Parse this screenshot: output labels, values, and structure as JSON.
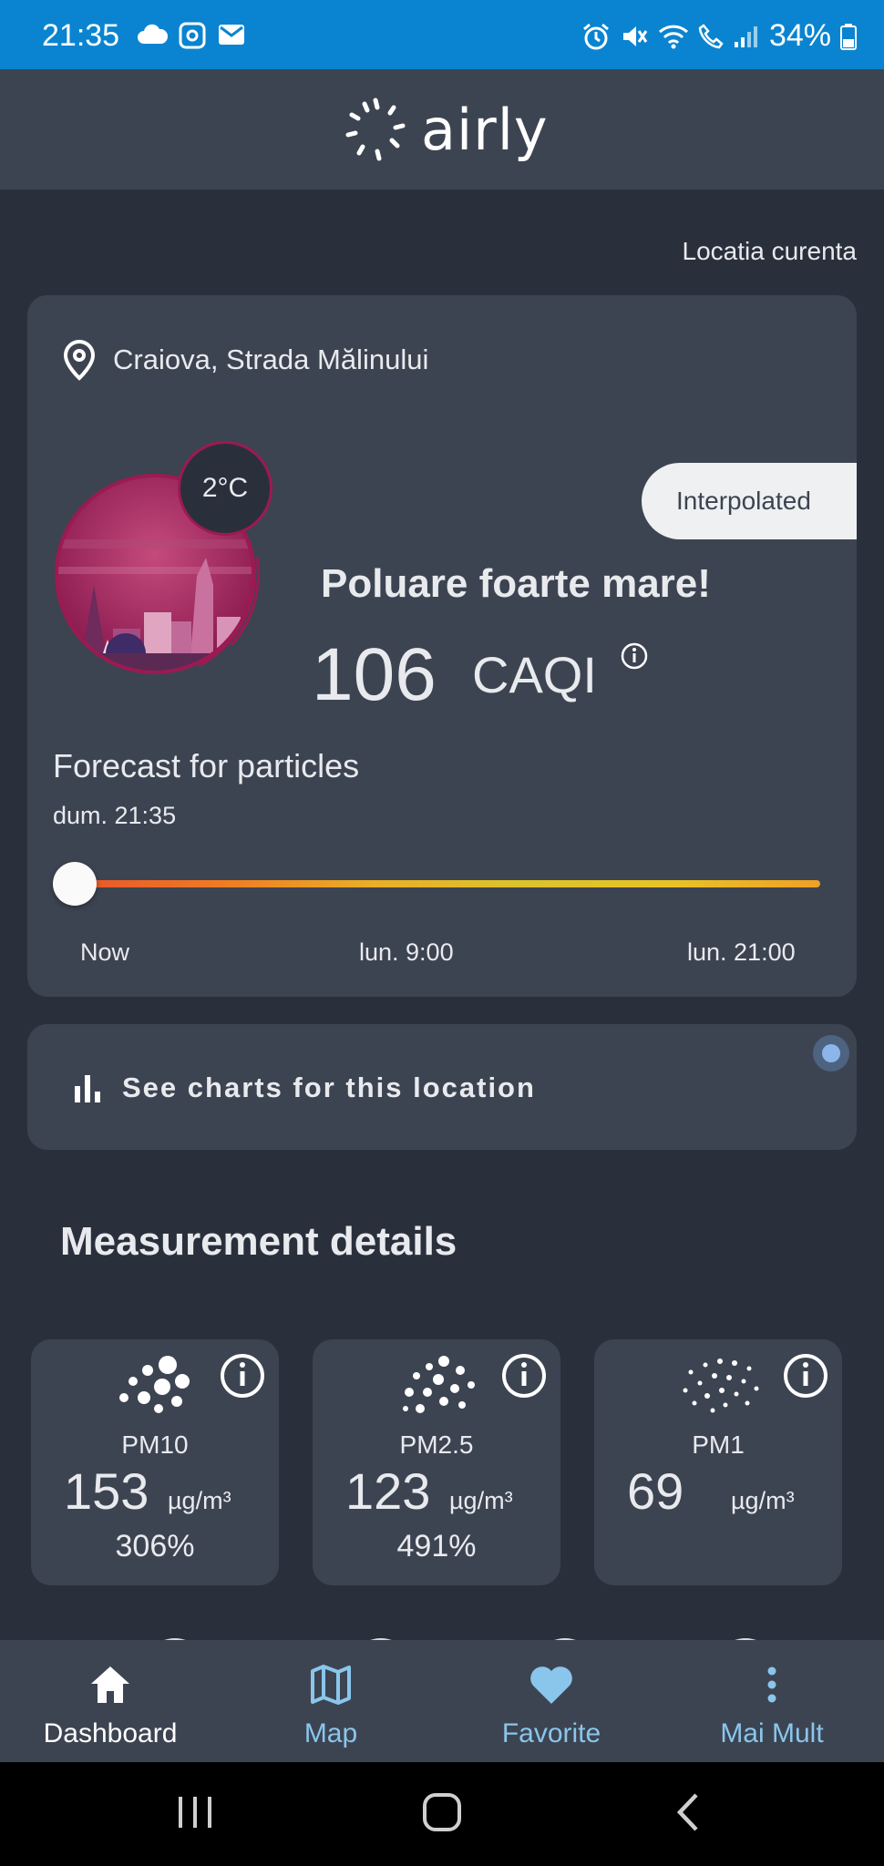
{
  "status_bar": {
    "time": "21:35",
    "battery": "34%",
    "left_icons": [
      "cloud-icon",
      "mail-icon"
    ],
    "right_icons": [
      "alarm-icon",
      "mute-icon",
      "wifi-icon",
      "call-icon",
      "signal-icon",
      "battery-icon"
    ]
  },
  "app": {
    "logo_text": "airly"
  },
  "location_link": "Locatia curenta",
  "main_card": {
    "location": "Craiova, Strada Mălinului",
    "temperature": "2°C",
    "badge": "Interpolated",
    "status": "Poluare foarte mare!",
    "caqi_value": "106",
    "caqi_label": "CAQI",
    "forecast": {
      "title": "Forecast for particles",
      "time": "dum. 21:35",
      "slider_position": 0,
      "ticks": [
        "Now",
        "lun. 9:00",
        "lun. 21:00"
      ]
    }
  },
  "charts_card": {
    "label": "See charts for this location"
  },
  "measurements": {
    "title": "Measurement details",
    "items": [
      {
        "name": "PM10",
        "value": "153",
        "unit": "µg/m³",
        "percent": "306%"
      },
      {
        "name": "PM2.5",
        "value": "123",
        "unit": "µg/m³",
        "percent": "491%"
      },
      {
        "name": "PM1",
        "value": "69",
        "unit": "µg/m³",
        "percent": ""
      }
    ]
  },
  "bottom_nav": [
    {
      "label": "Dashboard",
      "icon": "home-icon",
      "active": true
    },
    {
      "label": "Map",
      "icon": "map-icon",
      "active": false
    },
    {
      "label": "Favorite",
      "icon": "heart-icon",
      "active": false
    },
    {
      "label": "Mai Mult",
      "icon": "more-vertical-icon",
      "active": false
    }
  ],
  "colors": {
    "status_bar": "#0a84d0",
    "background": "#2a303b",
    "card": "#3d4451",
    "accent_nav": "#8ac6ec",
    "pollution_ring": "#9c1a52"
  }
}
